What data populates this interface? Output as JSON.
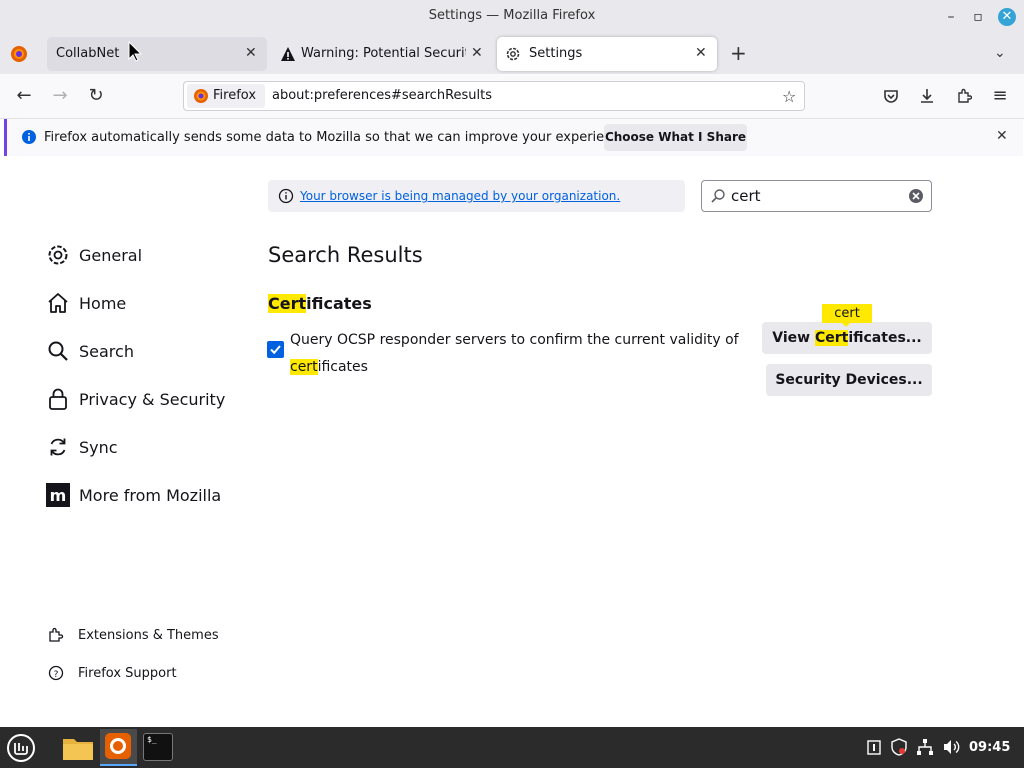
{
  "window": {
    "title": "Settings — Mozilla Firefox"
  },
  "tabs": [
    {
      "label": "CollabNet",
      "active": false
    },
    {
      "label": "Warning: Potential Security Risk Ahead",
      "active": false
    },
    {
      "label": "Settings",
      "active": true
    }
  ],
  "urlbar": {
    "identity_label": "Firefox",
    "url": "about:preferences#searchResults"
  },
  "notification": {
    "message": "Firefox automatically sends some data to Mozilla so that we can improve your experience.",
    "button": "Choose What I Share"
  },
  "sidebar": {
    "items": [
      {
        "label": "General",
        "icon": "gear-icon"
      },
      {
        "label": "Home",
        "icon": "home-icon"
      },
      {
        "label": "Search",
        "icon": "search-icon"
      },
      {
        "label": "Privacy & Security",
        "icon": "lock-icon"
      },
      {
        "label": "Sync",
        "icon": "sync-icon"
      },
      {
        "label": "More from Mozilla",
        "icon": "mozilla-icon"
      }
    ],
    "footer": [
      {
        "label": "Extensions & Themes",
        "icon": "puzzle-icon"
      },
      {
        "label": "Firefox Support",
        "icon": "help-icon"
      }
    ]
  },
  "policy_notice": "Your browser is being managed by your organization.",
  "search": {
    "value": "cert"
  },
  "main": {
    "heading": "Search Results",
    "section": {
      "hl": "Cert",
      "rest": "ificates"
    },
    "ocsp": {
      "checked": true,
      "line1": "Query OCSP responder servers to confirm the current validity of",
      "line2_hl": "cert",
      "line2_rest": "ificates"
    },
    "view_btn": {
      "pre": "View ",
      "hl": "Cert",
      "rest": "ificates..."
    },
    "tooltip": "cert",
    "devices_btn": "Security Devices..."
  },
  "taskbar": {
    "clock": "09:45"
  },
  "colors": {
    "accent": "#0061e0",
    "highlight": "#ffe900",
    "notif_border": "#7543e3"
  }
}
